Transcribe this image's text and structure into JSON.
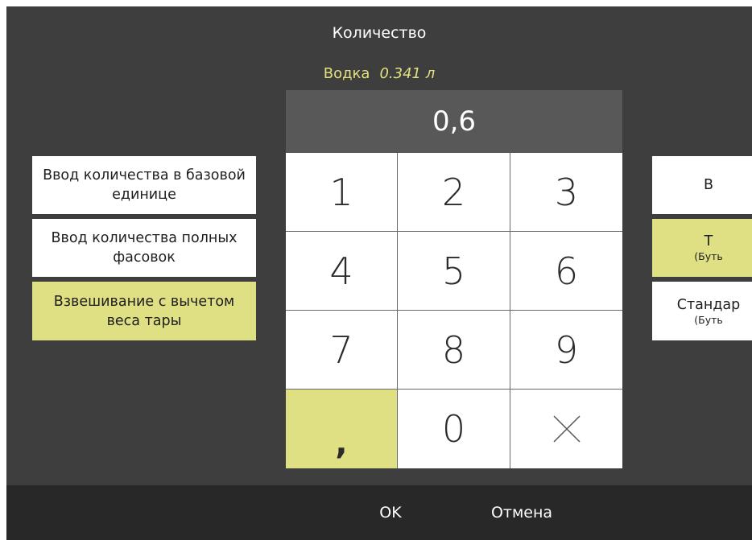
{
  "dialog": {
    "title": "Количество",
    "product_name": "Водка",
    "product_qty": "0.341 л",
    "display_value": "0,6"
  },
  "keypad": {
    "keys": [
      "1",
      "2",
      "3",
      "4",
      "5",
      "6",
      "7",
      "8",
      "9",
      ",",
      "0"
    ],
    "clear_icon": "close-icon"
  },
  "left_options": [
    {
      "label": "Ввод количества в базовой единице",
      "active": false
    },
    {
      "label": "Ввод количества полных фасовок",
      "active": false
    },
    {
      "label": "Взвешивание с вычетом веса тары",
      "active": true
    }
  ],
  "right_options": [
    {
      "label": "В",
      "sub": "",
      "active": false
    },
    {
      "label": "Т",
      "sub": "(Буть",
      "active": true
    },
    {
      "label": "Стандар",
      "sub": "(Буть",
      "active": false
    }
  ],
  "footer": {
    "ok_label": "OK",
    "cancel_label": "Отмена"
  },
  "colors": {
    "accent": "#dfdf83",
    "background": "#3d3e3d",
    "footer": "#282828",
    "display": "#575857"
  }
}
